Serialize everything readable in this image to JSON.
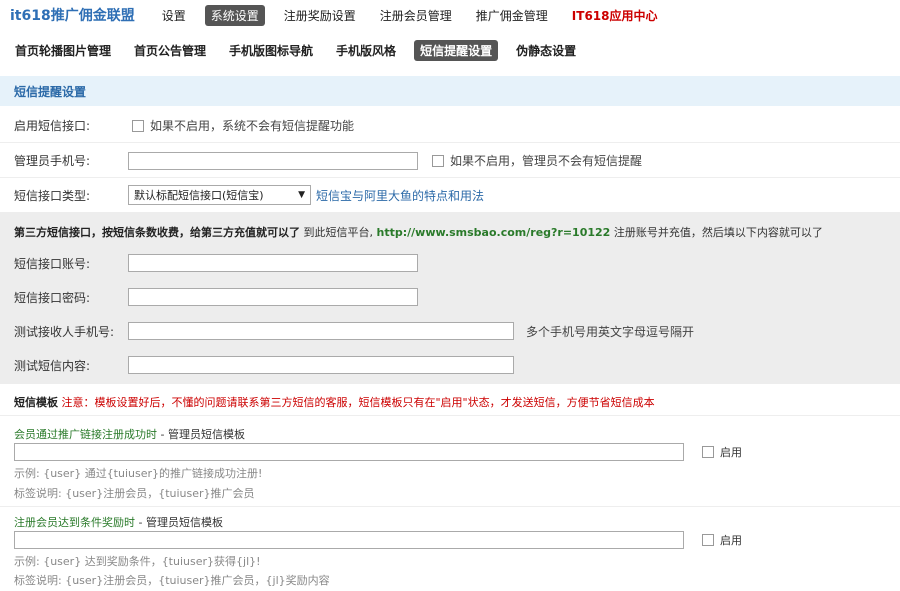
{
  "topnav": {
    "brand": "it618推广佣金联盟",
    "items": [
      "设置",
      "系统设置",
      "注册奖励设置",
      "注册会员管理",
      "推广佣金管理",
      "IT618应用中心"
    ]
  },
  "subnav": {
    "items": [
      "首页轮播图片管理",
      "首页公告管理",
      "手机版图标导航",
      "手机版风格",
      "短信提醒设置",
      "伪静态设置"
    ]
  },
  "section": {
    "title": "短信提醒设置"
  },
  "form": {
    "enable_sms": {
      "label": "启用短信接口:",
      "hint": "如果不启用，系统不会有短信提醒功能"
    },
    "admin_phone": {
      "label": "管理员手机号:",
      "value": "",
      "hint": "如果不启用，管理员不会有短信提醒"
    },
    "sms_type": {
      "label": "短信接口类型:",
      "selected": "默认标配短信接口(短信宝)",
      "link": "短信宝与阿里大鱼的特点和用法"
    }
  },
  "third_party": {
    "bold": "第三方短信接口，按短信条数收费，给第三方充值就可以了",
    "before_url": "到此短信平台,",
    "url": "http://www.smsbao.com/reg?r=10122",
    "after_url": "注册账号并充值，然后填以下内容就可以了",
    "account": {
      "label": "短信接口账号:",
      "value": ""
    },
    "password": {
      "label": "短信接口密码:",
      "value": ""
    },
    "test_phone": {
      "label": "测试接收人手机号:",
      "value": "",
      "hint": "多个手机号用英文字母逗号隔开"
    },
    "test_content": {
      "label": "测试短信内容:",
      "value": ""
    }
  },
  "templates": {
    "heading": "短信模板",
    "notice": "注意：模板设置好后，不懂的问题请联系第三方短信的客服，短信模板只有在\"启用\"状态，才发送短信，方便节省短信成本",
    "enable_label": "启用",
    "items": [
      {
        "title": "会员通过推广链接注册成功时",
        "suffix": " - 管理员短信模板",
        "value": "",
        "example": "示例: {user} 通过{tuiuser}的推广链接成功注册!",
        "tags": "标签说明: {user}注册会员，{tuiuser}推广会员"
      },
      {
        "title": "注册会员达到条件奖励时",
        "suffix": " - 管理员短信模板",
        "value": "",
        "example": "示例: {user} 达到奖励条件，{tuiuser}获得{jl}!",
        "tags": "标签说明: {user}注册会员，{tuiuser}推广会员，{jl}奖励内容"
      }
    ]
  }
}
